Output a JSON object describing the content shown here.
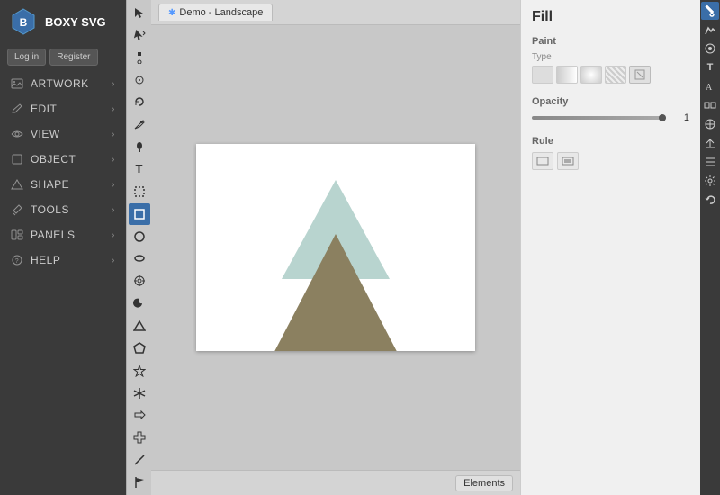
{
  "app": {
    "title": "BOXY SVG",
    "logo_text": "B"
  },
  "auth": {
    "login_label": "Log in",
    "register_label": "Register"
  },
  "nav": {
    "items": [
      {
        "id": "artwork",
        "label": "ARTWORK",
        "icon": "image-icon"
      },
      {
        "id": "edit",
        "label": "EDIT",
        "icon": "edit-icon"
      },
      {
        "id": "view",
        "label": "VIEW",
        "icon": "view-icon"
      },
      {
        "id": "object",
        "label": "OBJECT",
        "icon": "object-icon"
      },
      {
        "id": "shape",
        "label": "SHAPE",
        "icon": "shape-icon"
      },
      {
        "id": "tools",
        "label": "TOOLS",
        "icon": "tools-icon"
      },
      {
        "id": "panels",
        "label": "PANELS",
        "icon": "panels-icon"
      },
      {
        "id": "help",
        "label": "HELP",
        "icon": "help-icon"
      }
    ]
  },
  "tab": {
    "label": "Demo - Landscape"
  },
  "fill_panel": {
    "title": "Fill",
    "paint_label": "Paint",
    "type_label": "Type",
    "opacity_label": "Opacity",
    "opacity_value": "1",
    "rule_label": "Rule",
    "paint_types": [
      {
        "id": "solid",
        "label": ""
      },
      {
        "id": "linear",
        "label": ""
      },
      {
        "id": "radial",
        "label": ""
      },
      {
        "id": "pattern",
        "label": ""
      },
      {
        "id": "swatch",
        "label": ""
      }
    ]
  },
  "bottom_bar": {
    "elements_label": "Elements"
  },
  "colors": {
    "triangle_top": "#b8d4cf",
    "triangle_bottom": "#8b8060",
    "active_tool_bg": "#3a6ea8",
    "sidebar_bg": "#3a3a3a"
  }
}
